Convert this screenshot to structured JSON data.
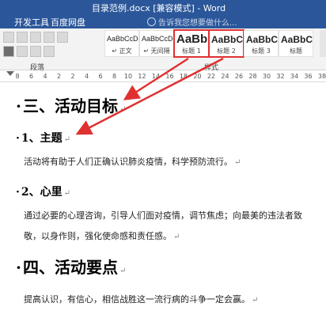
{
  "window": {
    "title": "目录范例.docx [兼容模式] - Word"
  },
  "tabs": [
    "开发工具",
    "百度网盘"
  ],
  "tell_me": {
    "placeholder": "告诉我您想要做什么..."
  },
  "ribbon": {
    "group_paragraph": "段落",
    "group_styles": "样式",
    "styles": [
      {
        "preview": "AaBbCcDd",
        "name": "↵ 正文",
        "highlighted": false
      },
      {
        "preview": "AaBbCcDd",
        "name": "↵ 无间隔",
        "highlighted": false
      },
      {
        "preview": "AaBb",
        "name": "标题 1",
        "highlighted": true
      },
      {
        "preview": "AaBbC",
        "name": "标题 2",
        "highlighted": true
      },
      {
        "preview": "AaBbC",
        "name": "标题 3",
        "highlighted": false
      },
      {
        "preview": "AaBbC",
        "name": "标题",
        "highlighted": false
      }
    ]
  },
  "ruler": {
    "ticks": [
      "8",
      "6",
      "4",
      "2",
      "2",
      "4",
      "6",
      "8",
      "10",
      "12",
      "14",
      "16",
      "18",
      "20",
      "22",
      "24",
      "26",
      "28",
      "30",
      "32",
      "34",
      "36",
      "38"
    ]
  },
  "document": {
    "heading3": "三、活动目标",
    "sub1": "1、主题",
    "para1": "活动将有助于人们正确认识肺炎疫情，科学预防流行。",
    "sub2": "2、心里",
    "para2": "通过必要的心理咨询，引导人们面对疫情，调节焦虑；向最美的违法者致敬，以身作则，强化使命感和责任感。",
    "heading4": "四、活动要点",
    "para3": "提高认识，有信心，相信战胜这一流行病的斗争一定会赢。",
    "para_mark": "↵",
    "bullet": "·"
  },
  "colors": {
    "title_bar": "#2b579a",
    "highlight": "#e03131"
  }
}
